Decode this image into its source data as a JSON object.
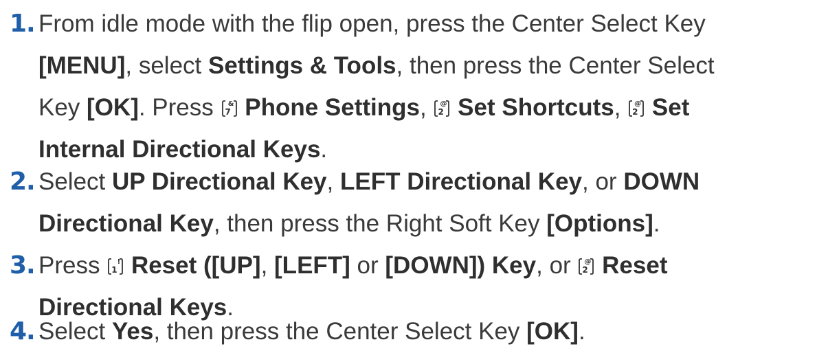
{
  "steps": [
    {
      "number": "1.",
      "l1": {
        "t1": "From idle mode with the flip open, press the Center Select Key"
      },
      "l2": {
        "b1": "[MENU]",
        "t1": ", select ",
        "b2": "Settings & Tools",
        "t2": ", then press the Center Select"
      },
      "l3": {
        "t1": "Key ",
        "b1": "[OK]",
        "t2": ". Press ",
        "key1": {
          "main": "7",
          "sym": "&"
        },
        "b2": "Phone Settings",
        "t3": ", ",
        "key2": {
          "main": "2",
          "sym": "@"
        },
        "b3": "Set Shortcuts",
        "t4": ", ",
        "key3": {
          "main": "2",
          "sym": "@"
        },
        "b4": "Set"
      },
      "l4": {
        "b1": "Internal Directional Keys",
        "t1": "."
      }
    },
    {
      "number": "2.",
      "l1": {
        "t1": "Select ",
        "b1": "UP Directional Key",
        "t2": ", ",
        "b2": "LEFT Directional Key",
        "t3": ", or ",
        "b3": "DOWN"
      },
      "l2": {
        "b1": "Directional Key",
        "t1": ", then press the Right Soft Key ",
        "b2": "[Options]",
        "t2": "."
      }
    },
    {
      "number": "3.",
      "l1": {
        "t1": "Press ",
        "key1": {
          "main": "1",
          "sym": "!"
        },
        "b1": "Reset ([UP]",
        "t2": ", ",
        "b2": "[LEFT]",
        "t3": " or ",
        "b3": "[DOWN]) Key",
        "t4": ", or ",
        "key2": {
          "main": "2",
          "sym": "@"
        },
        "b4": "Reset"
      },
      "l2": {
        "b1": "Directional Keys",
        "t1": "."
      }
    },
    {
      "number": "4.",
      "l1": {
        "t1": "Select ",
        "b1": "Yes",
        "t2": ", then press the Center Select Key ",
        "b2": "[OK]",
        "t3": "."
      }
    }
  ]
}
